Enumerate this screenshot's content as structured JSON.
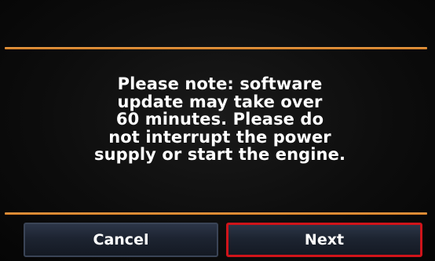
{
  "dialog": {
    "message_lines": [
      "Please note: software",
      "update may take over",
      "60 minutes. Please do",
      "not interrupt the power",
      "supply or start the engine."
    ]
  },
  "buttons": {
    "cancel_label": "Cancel",
    "next_label": "Next"
  },
  "colors": {
    "accent_rule": "#e8903a",
    "focus_border": "#d0141a",
    "background": "#0d0d0d",
    "text": "#ffffff"
  }
}
